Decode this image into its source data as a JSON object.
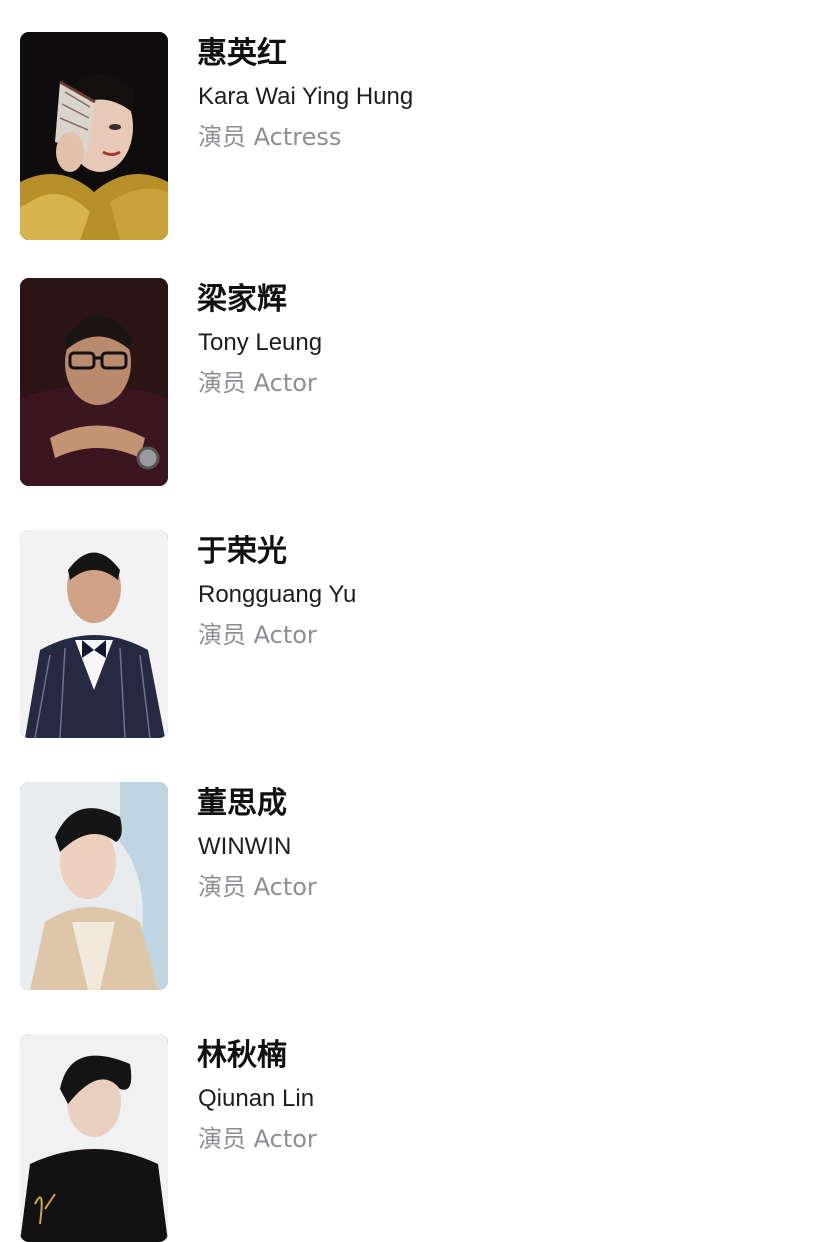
{
  "cast": [
    {
      "name_zh": "惠英红",
      "name_en": "Kara Wai Ying Hung",
      "role": "演员 Actress"
    },
    {
      "name_zh": "梁家辉",
      "name_en": "Tony Leung",
      "role": "演员 Actor"
    },
    {
      "name_zh": "于荣光",
      "name_en": "Rongguang Yu",
      "role": "演员 Actor"
    },
    {
      "name_zh": "董思成",
      "name_en": "WINWIN",
      "role": "演员 Actor"
    },
    {
      "name_zh": "林秋楠",
      "name_en": "Qiunan Lin",
      "role": "演员 Actor"
    }
  ]
}
